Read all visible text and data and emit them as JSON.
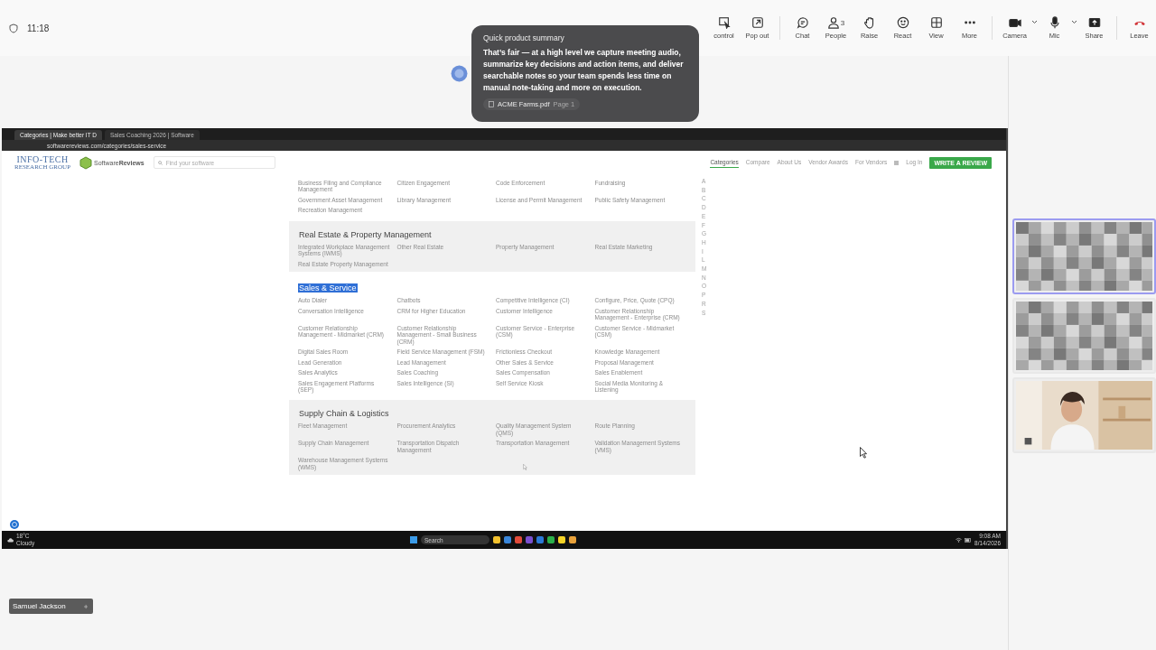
{
  "meeting_bar": {
    "time": "11:18",
    "controls": [
      {
        "kind": "take-control",
        "label": "control"
      },
      {
        "kind": "pop-out",
        "label": "Pop out"
      },
      {
        "kind": "chat",
        "label": "Chat"
      },
      {
        "kind": "people",
        "label": "People",
        "count": "3"
      },
      {
        "kind": "raise",
        "label": "Raise"
      },
      {
        "kind": "react",
        "label": "React"
      },
      {
        "kind": "view",
        "label": "View"
      },
      {
        "kind": "more",
        "label": "More"
      },
      {
        "kind": "camera",
        "label": "Camera",
        "dropdown": true
      },
      {
        "kind": "mic",
        "label": "Mic",
        "dropdown": true
      },
      {
        "kind": "share",
        "label": "Share"
      },
      {
        "kind": "leave",
        "label": "Leave"
      }
    ]
  },
  "summary_popup": {
    "title": "Quick product summary",
    "text": "That’s fair — at a high level we capture meeting audio, summarize key decisions and action items, and deliver searchable notes so your team spends less time on manual note-taking and more on execution.",
    "attachment": {
      "name": "ACME Farms.pdf",
      "page": "Page 1"
    }
  },
  "shared_screen": {
    "browser": {
      "tabs": [
        {
          "title": "Categories | Make better IT D",
          "selected": true
        },
        {
          "title": "Sales Coaching 2026 | Software",
          "selected": false
        }
      ],
      "address": "softwarereviews.com/categories/sales-service"
    },
    "site": {
      "logo": "INFO-TECH",
      "logo_sub": "RESEARCH GROUP",
      "brand": "Software**Reviews**",
      "search": {
        "placeholder": "Find your software"
      },
      "nav": [
        {
          "label": "Categories",
          "selected": true
        },
        {
          "label": "Compare",
          "selected": false
        },
        {
          "label": "About Us",
          "selected": false
        },
        {
          "label": "Vendor Awards",
          "selected": false
        },
        {
          "label": "For Vendors",
          "selected": false
        },
        {
          "label": "Log In",
          "selected": false
        }
      ],
      "cta": "WRITE A REVIEW",
      "sections": [
        {
          "shaded": false,
          "items": [
            "Business Filing and Compliance Management",
            "Citizen Engagement",
            "Code Enforcement",
            "Fundraising",
            "Government Asset Management",
            "Library Management",
            "License and Permit Management",
            "Public Safety Management",
            "Recreation Management"
          ]
        },
        {
          "heading": "Real Estate & Property Management",
          "shaded": true,
          "highlighted": false,
          "items": [
            "Integrated Workplace Management Systems (IWMS)",
            "Other Real Estate",
            "Property Management",
            "Real Estate Marketing",
            "Real Estate Property Management"
          ]
        },
        {
          "heading": "Sales & Service",
          "shaded": false,
          "highlighted": true,
          "items": [
            "Auto Dialer",
            "Chatbots",
            "Competitive Intelligence (CI)",
            "Configure, Price, Quote (CPQ)",
            "Conversation Intelligence",
            "CRM for Higher Education",
            "Customer Intelligence",
            "Customer Relationship Management - Enterprise (CRM)",
            "Customer Relationship Management - Midmarket (CRM)",
            "Customer Relationship Management - Small Business (CRM)",
            "Customer Service - Enterprise (CSM)",
            "Customer Service - Midmarket (CSM)",
            "Digital Sales Room",
            "Field Service Management (FSM)",
            "Frictionless Checkout",
            "Knowledge Management",
            "Lead Generation",
            "Lead Management",
            "Other Sales & Service",
            "Proposal Management",
            "Sales Analytics",
            "Sales Coaching",
            "Sales Compensation",
            "Sales Enablement",
            "Sales Engagement Platforms (SEP)",
            "Sales Intelligence (SI)",
            "Self Service Kiosk",
            "Social Media Monitoring & Listening"
          ]
        },
        {
          "heading": "Supply Chain & Logistics",
          "shaded": true,
          "highlighted": false,
          "items": [
            "Fleet Management",
            "Procurement Analytics",
            "Quality Management System (QMS)",
            "Route Planning",
            "Supply Chain Management",
            "Transportation Dispatch Management",
            "Transportation Management",
            "Validation Management Systems (VMS)",
            "Warehouse Management Systems (WMS)"
          ]
        }
      ],
      "alphabet": [
        "A",
        "B",
        "C",
        "D",
        "E",
        "F",
        "G",
        "H",
        "I",
        "L",
        "M",
        "N",
        "O",
        "P",
        "R",
        "S"
      ]
    },
    "taskbar": {
      "weather": "18°C",
      "condition": "Cloudy",
      "search": {
        "placeholder": "Search"
      },
      "time": "9:08 AM",
      "date": "8/14/2026"
    }
  },
  "participants": [
    {
      "kind": "pixelated",
      "speaking": true
    },
    {
      "kind": "pixelated",
      "speaking": false
    },
    {
      "kind": "camera",
      "speaking": false
    }
  ],
  "name_tag": {
    "name": "Samuel Jackson"
  }
}
